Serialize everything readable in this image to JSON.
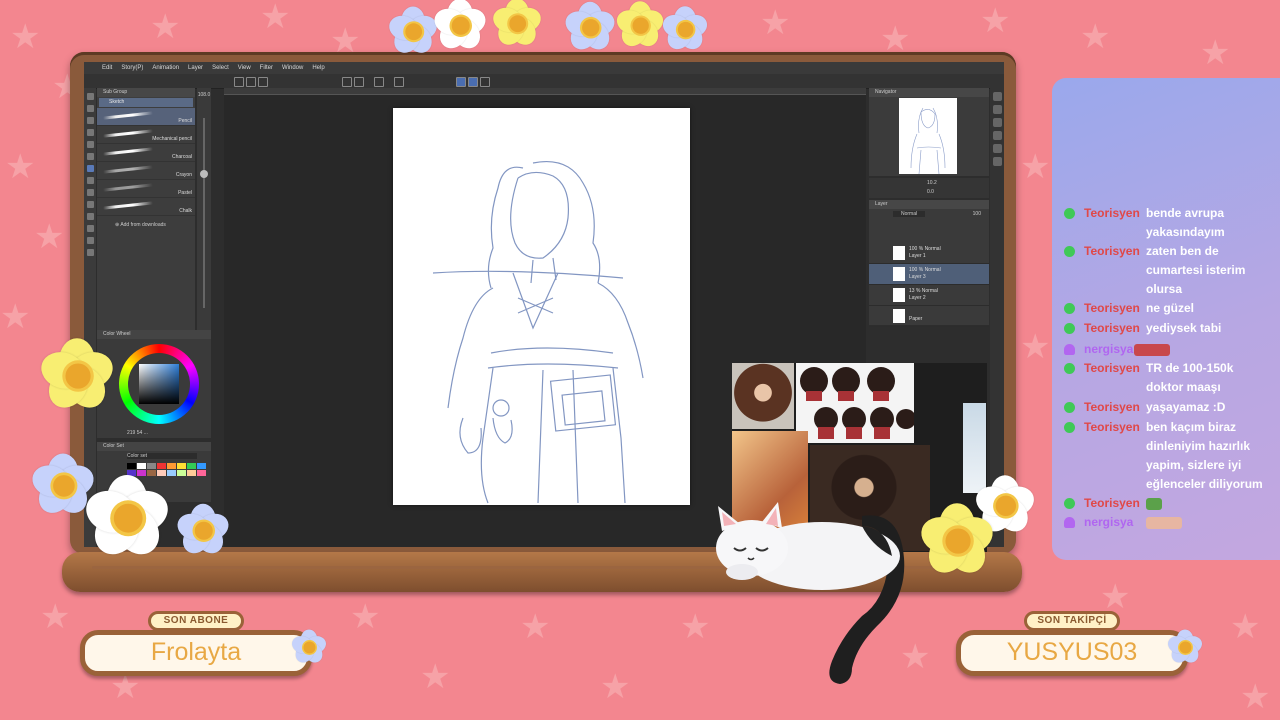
{
  "app_menu": [
    "Edit",
    "Story(P)",
    "Animation",
    "Layer",
    "Select",
    "View",
    "Filter",
    "Window",
    "Help"
  ],
  "brush_panel": {
    "title": "Sub Group",
    "sub_tool": "Sketch",
    "brushes": [
      "Pencil",
      "Mechanical pencil",
      "Charcoal",
      "Crayon",
      "Pastel",
      "Chalk"
    ],
    "selected_index": 0,
    "add_label": "Add from downloads",
    "size_value": "108.0"
  },
  "color_panel": {
    "title": "Color Wheel",
    "readout": "219 54 ..."
  },
  "color_set": {
    "title": "Color Set",
    "selected": "Color set"
  },
  "navigator": {
    "title": "Navigator",
    "zoom": "10.2",
    "rotation": "0.0"
  },
  "layer_panel": {
    "title": "Layer",
    "blend_mode": "Normal",
    "opacity": "100",
    "layers": [
      {
        "meta": "100 % Normal",
        "name": "Layer 1",
        "selected": false
      },
      {
        "meta": "100 % Normal",
        "name": "Layer 3",
        "selected": true
      },
      {
        "meta": "13 % Normal",
        "name": "Layer 2",
        "selected": false
      },
      {
        "meta": "",
        "name": "Paper",
        "selected": false
      }
    ]
  },
  "chat": {
    "messages": [
      {
        "user": "Teorisyen",
        "text": "bende avrupa yakasındayım",
        "badge": "green"
      },
      {
        "user": "Teorisyen",
        "text": "zaten ben de cumartesi isterim olursa",
        "badge": "green"
      },
      {
        "user": "Teorisyen",
        "text": "ne güzel",
        "badge": "green"
      },
      {
        "user": "Teorisyen",
        "text": "yediysek tabi",
        "badge": "green"
      },
      {
        "user": "nergisya",
        "text": "",
        "badge": "purple",
        "emote": "#c8484c"
      },
      {
        "user": "Teorisyen",
        "text": "TR de 100-150k doktor maaşı",
        "badge": "green"
      },
      {
        "user": "Teorisyen",
        "text": "yaşayamaz :D",
        "badge": "green"
      },
      {
        "user": "Teorisyen",
        "text": "ben kaçım biraz dinleniyim hazırlık yapim, sizlere iyi eğlenceler diliyorum",
        "badge": "green"
      },
      {
        "user": "Teorisyen",
        "text": "",
        "badge": "green",
        "emote": "#5ba14a"
      },
      {
        "user": "nergisya",
        "text": "",
        "badge": "purple",
        "emote": "#e7b6a2"
      }
    ]
  },
  "son_abone": {
    "label": "SON ABONE",
    "value": "Frolayta"
  },
  "son_takipci": {
    "label": "SON TAKİPÇİ",
    "value": "YUSYUS03"
  },
  "colors": {
    "background": "#f3868f",
    "frame": "#8a5a3b",
    "chat_bg": "#a9a6e8",
    "username": "#e04848"
  }
}
